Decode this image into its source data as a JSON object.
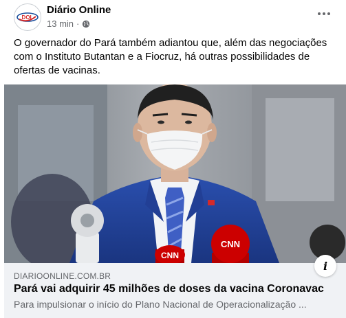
{
  "post": {
    "author": {
      "name": "Diário Online",
      "avatar_text": "DOL"
    },
    "timestamp": "13 min",
    "separator": "·",
    "privacy_icon": "globe-icon",
    "more_icon": "more-horizontal-icon",
    "text": "O governador do Pará também adiantou que, além das negociações com o Instituto Butantan e a Fiocruz, há outras possibilidades de ofertas de vacinas.",
    "image": {
      "microphone_logos": [
        "CNN",
        "CNN"
      ]
    },
    "link_preview": {
      "domain": "DIARIOONLINE.COM.BR",
      "title": "Pará vai adquirir 45 milhões de doses da vacina Coronavac",
      "description": "Para impulsionar o início do Plano Nacional de Operacionalização ...",
      "info_icon": "info-icon"
    }
  },
  "colors": {
    "text_primary": "#050505",
    "text_secondary": "#65676b",
    "preview_bg": "#f0f2f5",
    "suit_blue": "#1f3d8f",
    "cnn_red": "#cc0000"
  }
}
